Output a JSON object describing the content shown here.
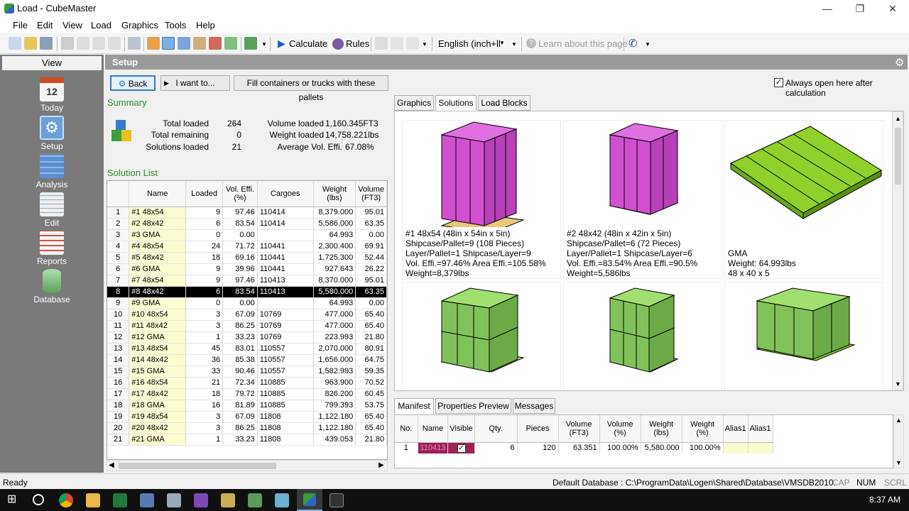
{
  "window": {
    "title": "Load - CubeMaster",
    "min": "—",
    "max": "❐",
    "close": "✕"
  },
  "menu": [
    "File",
    "Edit",
    "View",
    "Load",
    "Graphics",
    "Tools",
    "Help"
  ],
  "toolbar": {
    "calculate": "Calculate",
    "rules": "Rules",
    "language": "English (inch+ll",
    "learn": "Learn about this page"
  },
  "sidebar": {
    "header": "View",
    "items": [
      {
        "label": "Today",
        "color": "#e8e8e8"
      },
      {
        "label": "Setup",
        "color": "#6aa0d8"
      },
      {
        "label": "Analysis",
        "color": "#5b8fd0"
      },
      {
        "label": "Edit",
        "color": "#e8e8e8"
      },
      {
        "label": "Reports",
        "color": "#e8e8e8"
      },
      {
        "label": "Database",
        "color": "#7fbf7f"
      }
    ]
  },
  "setup": {
    "title": "Setup",
    "back": "Back",
    "iwant": "I want to...",
    "fill": "Fill containers or trucks with these pallets",
    "always_open": "Always open here after calculation"
  },
  "summary": {
    "title": "Summary",
    "total_loaded_label": "Total loaded",
    "total_loaded": "264",
    "total_remaining_label": "Total remaining",
    "total_remaining": "0",
    "solutions_loaded_label": "Solutions loaded",
    "solutions_loaded": "21",
    "volume_loaded_label": "Volume loaded",
    "volume_loaded": "1,160.345FT3",
    "weight_loaded_label": "Weight loaded",
    "weight_loaded": "14,758.221lbs",
    "avg_vol_label": "Average Vol. Effi.",
    "avg_vol": "67.08%"
  },
  "solution_list": {
    "title": "Solution List",
    "headers": [
      "",
      "Name",
      "Loaded",
      "Vol. Effi. (%)",
      "Cargoes",
      "Weight (lbs)",
      "Volume (FT3)"
    ],
    "rows": [
      [
        "1",
        "#1 48x54",
        "9",
        "97.46",
        "110414",
        "8,379.000",
        "95.01"
      ],
      [
        "2",
        "#2 48x42",
        "6",
        "83.54",
        "110414",
        "5,586.000",
        "63.35"
      ],
      [
        "3",
        "#3 GMA",
        "0",
        "0.00",
        "",
        "64.993",
        "0.00"
      ],
      [
        "4",
        "#4 48x54",
        "24",
        "71.72",
        "110441",
        "2,300.400",
        "69.91"
      ],
      [
        "5",
        "#5 48x42",
        "18",
        "69.16",
        "110441",
        "1,725.300",
        "52.44"
      ],
      [
        "6",
        "#6 GMA",
        "9",
        "39.96",
        "110441",
        "927.643",
        "26.22"
      ],
      [
        "7",
        "#7 48x54",
        "9",
        "97.46",
        "110413",
        "8,370.000",
        "95.01"
      ],
      [
        "8",
        "#8 48x42",
        "6",
        "83.54",
        "110413",
        "5,580.000",
        "63.35"
      ],
      [
        "9",
        "#9 GMA",
        "0",
        "0.00",
        "",
        "64.993",
        "0.00"
      ],
      [
        "10",
        "#10 48x54",
        "3",
        "67.09",
        "10769",
        "477.000",
        "65.40"
      ],
      [
        "11",
        "#11 48x42",
        "3",
        "86.25",
        "10769",
        "477.000",
        "65.40"
      ],
      [
        "12",
        "#12 GMA",
        "1",
        "33.23",
        "10769",
        "223.993",
        "21.80"
      ],
      [
        "13",
        "#13 48x54",
        "45",
        "83.01",
        "110557",
        "2,070.000",
        "80.91"
      ],
      [
        "14",
        "#14 48x42",
        "36",
        "85.38",
        "110557",
        "1,656.000",
        "64.75"
      ],
      [
        "15",
        "#15 GMA",
        "33",
        "90.46",
        "110557",
        "1,582.993",
        "59.35"
      ],
      [
        "16",
        "#16 48x54",
        "21",
        "72.34",
        "110885",
        "963.900",
        "70.52"
      ],
      [
        "17",
        "#17 48x42",
        "18",
        "79.72",
        "110885",
        "826.200",
        "60.45"
      ],
      [
        "18",
        "#18 GMA",
        "16",
        "81.89",
        "110885",
        "799.393",
        "53.75"
      ],
      [
        "19",
        "#19 48x54",
        "3",
        "67.09",
        "11808",
        "1,122.180",
        "65.40"
      ],
      [
        "20",
        "#20 48x42",
        "3",
        "86.25",
        "11808",
        "1,122.180",
        "65.40"
      ],
      [
        "21",
        "#21 GMA",
        "1",
        "33.23",
        "11808",
        "439.053",
        "21.80"
      ]
    ],
    "selected_row": "8"
  },
  "tabs": [
    "Graphics",
    "Solutions",
    "Load Blocks"
  ],
  "cards": [
    {
      "lines": [
        "#1 48x54  (48in x 54in x 5in)",
        "Shipcase/Pallet=9 (108 Pieces)",
        "Layer/Pallet=1  Shipcase/Layer=9",
        "Vol. Effi.=97.46% Area Effi.=105.58%",
        "Weight=8,379lbs"
      ],
      "color": "#d65fd6"
    },
    {
      "lines": [
        "#2 48x42  (48in x 42in x 5in)",
        "Shipcase/Pallet=6 (72 Pieces)",
        "Layer/Pallet=1  Shipcase/Layer=6",
        "Vol. Effi.=83.54% Area Effi.=90.5%",
        "Weight=5,586lbs"
      ],
      "color": "#d65fd6"
    },
    {
      "lines": [
        "GMA",
        "Weight: 64.993lbs",
        "48 x 40 x 5"
      ],
      "color": "#8fd12a"
    },
    {
      "lines": [],
      "color": "#7fc35a"
    },
    {
      "lines": [],
      "color": "#7fc35a"
    },
    {
      "lines": [],
      "color": "#7fc35a"
    }
  ],
  "bottom_tabs": [
    "Manifest",
    "Properties Preview",
    "Messages"
  ],
  "manifest": {
    "headers": [
      "No.",
      "Name",
      "Visible",
      "Qty.",
      "Pieces",
      "Volume (FT3)",
      "Volume (%)",
      "Weight (lbs)",
      "Weight (%)",
      "Alias1",
      "Alias1"
    ],
    "row": [
      "1",
      "110413",
      "✓",
      "6",
      "120",
      "63.351",
      "100.00%",
      "5,580.000",
      "100.00%",
      "",
      ""
    ]
  },
  "status": {
    "left": "Ready",
    "db": "Default Database : C:\\ProgramData\\Logen\\Shared\\Database\\VMSDB2010.",
    "cap": "CAP",
    "num": "NUM",
    "scrl": "SCRL"
  },
  "taskbar": {
    "time": "8:37 AM"
  }
}
